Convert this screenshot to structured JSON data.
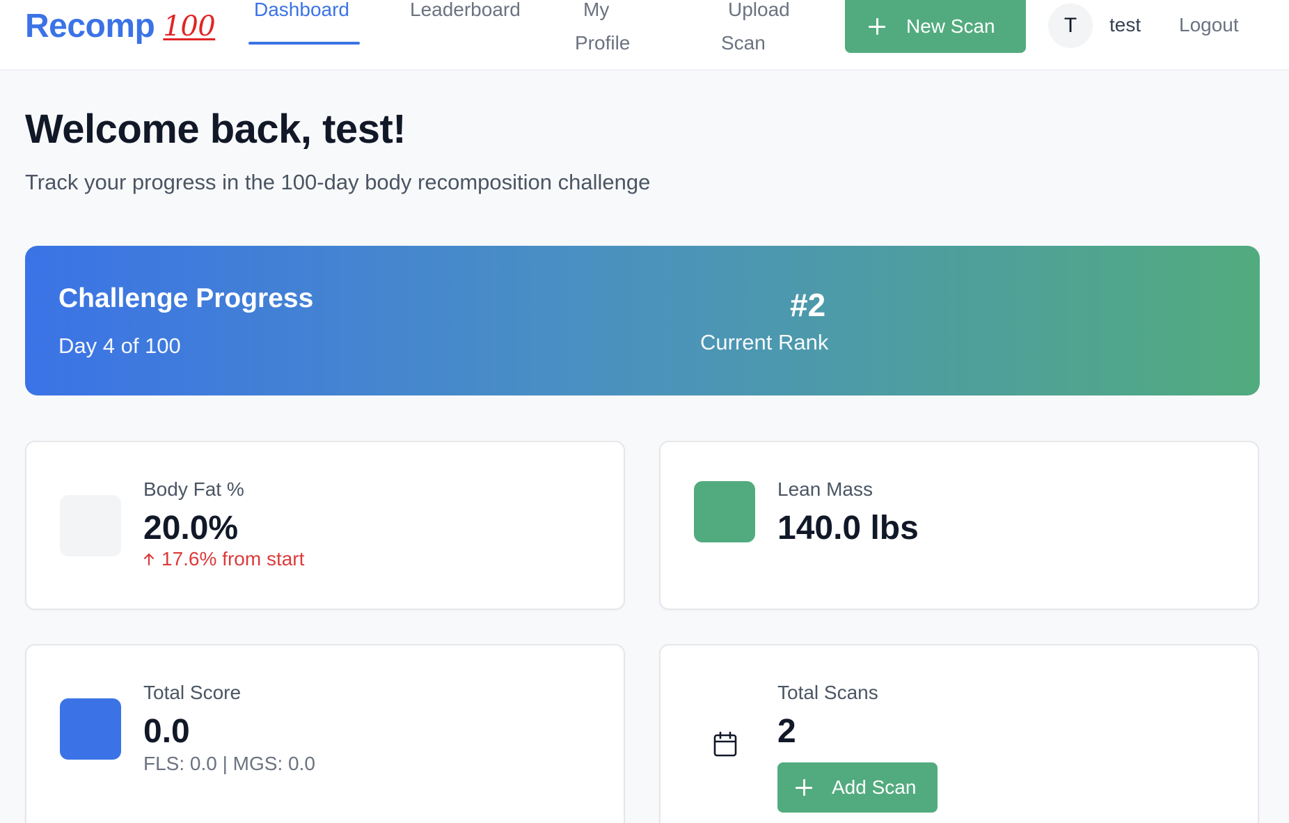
{
  "nav": {
    "brand": "Recomp",
    "brand_emoji": "100",
    "links": [
      {
        "label": "Dashboard",
        "active": true
      },
      {
        "label": "Leaderboard",
        "active": false
      },
      {
        "label_line1": "My",
        "label_line2": "Profile",
        "active": false
      },
      {
        "label_line1": "Upload",
        "label_line2": "Scan",
        "active": false
      }
    ],
    "new_scan_label": "New Scan",
    "avatar_initial": "T",
    "username": "test",
    "logout_label": "Logout"
  },
  "header": {
    "welcome": "Welcome back, test!",
    "subtitle": "Track your progress in the 100-day body recomposition challenge"
  },
  "banner": {
    "title": "Challenge Progress",
    "day_text": "Day 4 of 100",
    "rank": "#2",
    "rank_label": "Current Rank",
    "gradient_start": "#3b73e6",
    "gradient_end": "#52ab7e"
  },
  "stats": {
    "body_fat": {
      "label": "Body Fat %",
      "value": "20.0%",
      "change": "17.6% from start",
      "change_direction": "up",
      "tile_color": "#f3f4f6"
    },
    "lean_mass": {
      "label": "Lean Mass",
      "value": "140.0 lbs",
      "tile_color": "#52ab7e"
    },
    "total_score": {
      "label": "Total Score",
      "value": "0.0",
      "breakdown": "FLS: 0.0 | MGS: 0.0",
      "tile_color": "#3b73e6"
    },
    "total_scans": {
      "label": "Total Scans",
      "value": "2",
      "icon": "calendar-icon",
      "add_scan_label": "Add Scan"
    }
  },
  "colors": {
    "primary": "#3b73e6",
    "success": "#52ab7e",
    "danger": "#dc3b3b"
  }
}
